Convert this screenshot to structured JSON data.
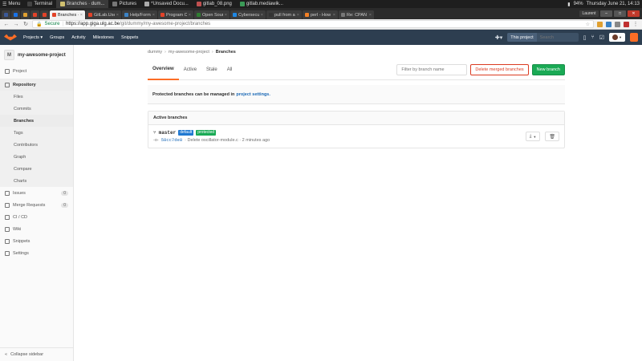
{
  "os": {
    "menu_label": "Menu",
    "tasks": [
      {
        "label": "Terminal",
        "color": "#444"
      },
      {
        "label": "Branches · dum...",
        "color": "#d0c070",
        "active": true
      },
      {
        "label": "Pictures",
        "color": "#777"
      },
      {
        "label": "*Unsaved Docu...",
        "color": "#aaa"
      },
      {
        "label": "gitlab_08.png",
        "color": "#c05050"
      },
      {
        "label": "gitlab.mediawik...",
        "color": "#3b9a57"
      }
    ],
    "battery": "94%",
    "clock": "Thursday June 21, 14:13"
  },
  "browser": {
    "tabs": [
      {
        "label": "Branches · dum",
        "color": "#e24329",
        "active": true
      },
      {
        "label": "GitLab.Use - Gi",
        "color": "#e24329"
      },
      {
        "label": "Help/Formatti",
        "color": "#3b82c4"
      },
      {
        "label": "Program Com",
        "color": "#e24329"
      },
      {
        "label": "Open Source D",
        "color": "#2f7d31"
      },
      {
        "label": "Cybersecu Soft",
        "color": "#1e88e5"
      },
      {
        "label": "pull from a coll",
        "color": "#333"
      },
      {
        "label": "perl - How can",
        "color": "#f48024"
      },
      {
        "label": "Re: CPAN pm m",
        "color": "#777"
      }
    ],
    "pinned_tab_colors": [
      "#3b5998",
      "#1a73e8",
      "#e0a030",
      "#e24329",
      "#e24329"
    ],
    "user_label": "Laurent",
    "secure_label": "Secure",
    "url_host": "https://app.giga.ulg.ac.be",
    "url_path": "/git/dummy/my-awesome-project/branches"
  },
  "gitlab": {
    "nav": [
      "Projects ▾",
      "Groups",
      "Activity",
      "Milestones",
      "Snippets"
    ],
    "search_scope": "This project",
    "search_placeholder": "Search"
  },
  "sidebar": {
    "project_initial": "M",
    "project_name": "my-awesome-project",
    "items": [
      {
        "label": "Project"
      },
      {
        "label": "Repository",
        "active": true
      }
    ],
    "repo_sub": [
      "Files",
      "Commits",
      "Branches",
      "Tags",
      "Contributors",
      "Graph",
      "Compare",
      "Charts"
    ],
    "active_sub": "Branches",
    "issues": {
      "label": "Issues",
      "count": "0"
    },
    "merge_requests": {
      "label": "Merge Requests",
      "count": "0"
    },
    "more": [
      "CI / CD",
      "Wiki",
      "Snippets",
      "Settings"
    ],
    "collapse_label": "Collapse sidebar"
  },
  "main": {
    "breadcrumbs": [
      "dummy",
      "my-awesome-project",
      "Branches"
    ],
    "tabs": [
      "Overview",
      "Active",
      "Stale",
      "All"
    ],
    "active_tab": "Overview",
    "filter_placeholder": "Filter by branch name",
    "delete_merged_label": "Delete merged branches",
    "new_branch_label": "New branch",
    "notice_text": "Protected branches can be managed in",
    "notice_link": "project settings.",
    "panel_title": "Active branches",
    "branch": {
      "name": "master",
      "badge_default": "default",
      "badge_protected": "protected",
      "sha": "58cc7de8",
      "commit_text": "· Delete oscillator-module.c · 2 minutes ago"
    }
  }
}
